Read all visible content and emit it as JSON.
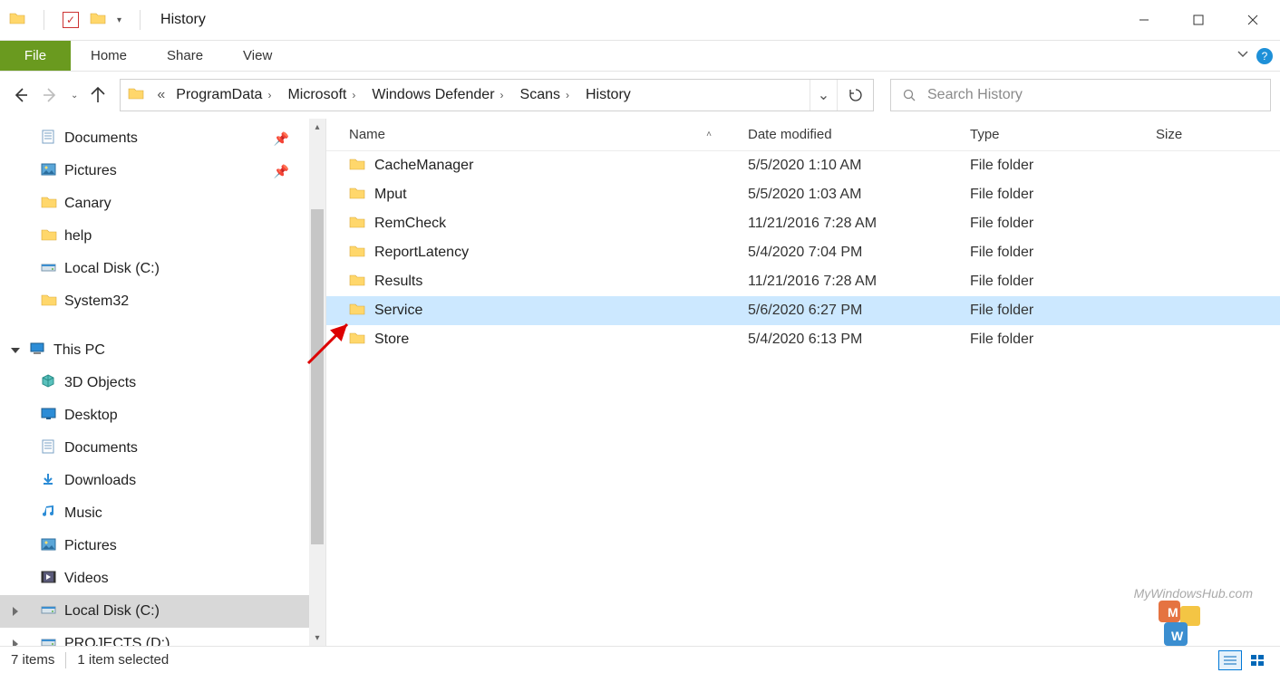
{
  "window": {
    "title": "History"
  },
  "ribbon": {
    "file": "File",
    "tabs": [
      "Home",
      "Share",
      "View"
    ]
  },
  "breadcrumbs": [
    "ProgramData",
    "Microsoft",
    "Windows Defender",
    "Scans",
    "History"
  ],
  "search": {
    "placeholder": "Search History"
  },
  "sidebar": {
    "quick_access": [
      {
        "label": "Documents",
        "icon": "document",
        "pinned": true
      },
      {
        "label": "Pictures",
        "icon": "pictures",
        "pinned": true
      },
      {
        "label": "Canary",
        "icon": "folder",
        "pinned": false
      },
      {
        "label": "help",
        "icon": "folder",
        "pinned": false
      },
      {
        "label": "Local Disk (C:)",
        "icon": "drive",
        "pinned": false
      },
      {
        "label": "System32",
        "icon": "folder",
        "pinned": false
      }
    ],
    "this_pc_label": "This PC",
    "this_pc": [
      {
        "label": "3D Objects",
        "icon": "3d"
      },
      {
        "label": "Desktop",
        "icon": "desktop"
      },
      {
        "label": "Documents",
        "icon": "document"
      },
      {
        "label": "Downloads",
        "icon": "downloads"
      },
      {
        "label": "Music",
        "icon": "music"
      },
      {
        "label": "Pictures",
        "icon": "pictures"
      },
      {
        "label": "Videos",
        "icon": "videos"
      },
      {
        "label": "Local Disk (C:)",
        "icon": "drive",
        "selected": true
      },
      {
        "label": "PROJECTS (D:)",
        "icon": "drive"
      }
    ]
  },
  "columns": {
    "name": "Name",
    "date": "Date modified",
    "type": "Type",
    "size": "Size"
  },
  "files": [
    {
      "name": "CacheManager",
      "date": "5/5/2020 1:10 AM",
      "type": "File folder"
    },
    {
      "name": "Mput",
      "date": "5/5/2020 1:03 AM",
      "type": "File folder"
    },
    {
      "name": "RemCheck",
      "date": "11/21/2016 7:28 AM",
      "type": "File folder"
    },
    {
      "name": "ReportLatency",
      "date": "5/4/2020 7:04 PM",
      "type": "File folder"
    },
    {
      "name": "Results",
      "date": "11/21/2016 7:28 AM",
      "type": "File folder"
    },
    {
      "name": "Service",
      "date": "5/6/2020 6:27 PM",
      "type": "File folder",
      "selected": true
    },
    {
      "name": "Store",
      "date": "5/4/2020 6:13 PM",
      "type": "File folder"
    }
  ],
  "status": {
    "count": "7 items",
    "selection": "1 item selected"
  },
  "watermark": "MyWindowsHub.com"
}
